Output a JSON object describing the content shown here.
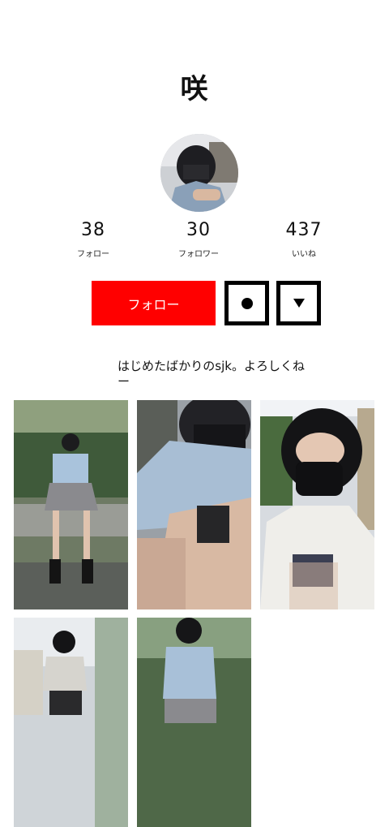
{
  "profile": {
    "name": "咲",
    "bio": "はじめたばかりのsjk。よろしくねー"
  },
  "stats": [
    {
      "value": "38",
      "label": "フォロー"
    },
    {
      "value": "30",
      "label": "フォロワー"
    },
    {
      "value": "437",
      "label": "いいね"
    }
  ],
  "actions": {
    "follow_label": "フォロー",
    "accent_color": "#ff0000"
  },
  "icons": {
    "message": "dot-icon",
    "more": "triangle-down-icon"
  }
}
